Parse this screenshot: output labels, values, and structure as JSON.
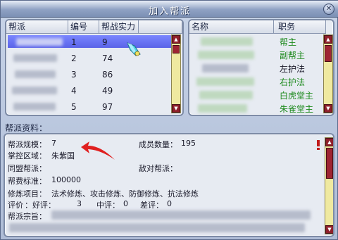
{
  "window": {
    "title": "加入帮派",
    "close_glyph": "✕"
  },
  "guild_list": {
    "headers": [
      "帮派",
      "编号",
      "帮战实力"
    ],
    "rows": [
      {
        "id": "1",
        "power": "9"
      },
      {
        "id": "2",
        "power": "74"
      },
      {
        "id": "3",
        "power": "86"
      },
      {
        "id": "4",
        "power": "49"
      },
      {
        "id": "5",
        "power": "97"
      }
    ],
    "selected_index": 0
  },
  "member_list": {
    "headers": [
      "名称",
      "职务"
    ],
    "roles": [
      "帮主",
      "副帮主",
      "左护法",
      "右护法",
      "白虎堂主",
      "朱雀堂主"
    ]
  },
  "details": {
    "section_label": "帮派资料：",
    "scale_label": "帮派规模：",
    "scale_value": "7",
    "members_label": "成员数量：",
    "members_value": "195",
    "territory_label": "掌控区域：",
    "territory_value": "朱紫国",
    "ally_label": "同盟帮派：",
    "enemy_label": "敌对帮派：",
    "fee_label": "帮费标准：",
    "fee_value": "100000",
    "training_label": "修炼项目：",
    "training_value": "法术修炼、攻击修炼、防御修炼、抗法修炼",
    "rating_label": "评价",
    "rating_good_label": "：好评：",
    "rating_good_value": "3",
    "rating_mid_label": "中评：",
    "rating_mid_value": "0",
    "rating_bad_label": "差评：",
    "rating_bad_value": "0",
    "motto_label": "帮派宗旨："
  },
  "colors": {
    "role_green": "#1e8a1e",
    "annotation_arrow": "#e02020",
    "selection": "#6a74f4",
    "scrollbar_track": "#efe9a0",
    "scrollbar_button": "#8f1f2a"
  }
}
